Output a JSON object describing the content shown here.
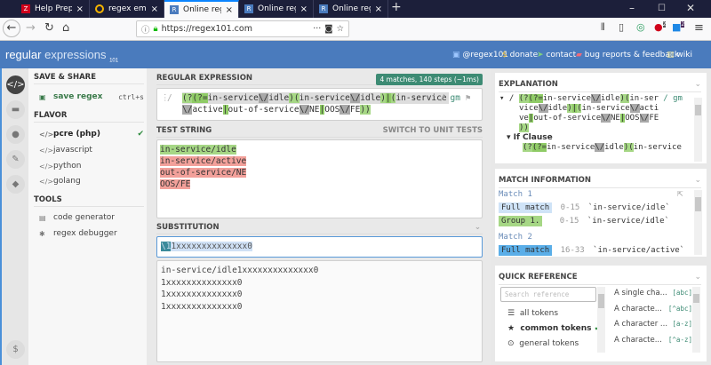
{
  "browser": {
    "tabs": [
      {
        "title": "Help Preprocessing: value s",
        "icon": "Z",
        "color": "#d0021b"
      },
      {
        "title": "regex emulator - Qwant Re",
        "icon": "Q",
        "color": "#5c6bc0"
      },
      {
        "title": "Online regex tester and deb",
        "icon": "R",
        "color": "#4a7bbd",
        "active": true
      },
      {
        "title": "Online regex tester and deb",
        "icon": "R",
        "color": "#4a7bbd"
      },
      {
        "title": "Online regex tester and deb",
        "icon": "R",
        "color": "#4a7bbd"
      }
    ],
    "new_tab": "+",
    "url": "https://regex101.com",
    "badge1": "2",
    "badge2": "2"
  },
  "header": {
    "logo_a": "regular",
    "logo_b": "expressions",
    "logo_c": "101",
    "links": [
      "@regex101",
      "donate",
      "contact",
      "bug reports & feedback",
      "wiki"
    ]
  },
  "sidebar": {
    "save_share": "SAVE & SHARE",
    "save_regex": "save regex",
    "save_shortcut": "ctrl+s",
    "flavor": "FLAVOR",
    "flavors": [
      "pcre (php)",
      "javascript",
      "python",
      "golang"
    ],
    "tools": "TOOLS",
    "tool_items": [
      "code generator",
      "regex debugger"
    ],
    "icon_code": "</>"
  },
  "regex": {
    "title": "REGULAR EXPRESSION",
    "status": "4 matches, 140 steps (~1ms)",
    "delim": "/",
    "flags": "gm",
    "line1": [
      [
        "g",
        "(?"
      ],
      [
        "gd",
        "(?="
      ],
      [
        "",
        "in-service"
      ],
      [
        "gr",
        "\\/"
      ],
      [
        "",
        "idle"
      ],
      [
        "g",
        ")"
      ],
      [
        "g",
        "("
      ],
      [
        "",
        "in-service"
      ],
      [
        "gr",
        "\\/"
      ],
      [
        "",
        "idle"
      ],
      [
        "g",
        ")"
      ],
      [
        "gd",
        "|"
      ],
      [
        "g",
        "("
      ],
      [
        "",
        "in-service"
      ]
    ],
    "line2": [
      [
        "gr",
        "\\/"
      ],
      [
        "",
        "active"
      ],
      [
        "gd",
        "|"
      ],
      [
        "",
        "out-of-service"
      ],
      [
        "gr",
        "\\/"
      ],
      [
        "",
        "NE"
      ],
      [
        "gd",
        "|"
      ],
      [
        "",
        "OOS"
      ],
      [
        "gr",
        "\\/"
      ],
      [
        "",
        "FE"
      ],
      [
        "g",
        "))"
      ]
    ]
  },
  "test": {
    "title": "TEST STRING",
    "switch": "SWITCH TO UNIT TESTS",
    "lines": [
      [
        "g",
        "in-service/idle"
      ],
      [
        "r",
        "in-service/active"
      ],
      [
        "r",
        "out-of-service/NE"
      ],
      [
        "r",
        "OOS/FE"
      ]
    ]
  },
  "substitution": {
    "title": "SUBSTITUTION",
    "input_ref": "\\1",
    "input_rest": "1xxxxxxxxxxxxxx0",
    "results": [
      "in-service/idle1xxxxxxxxxxxxxx0",
      "1xxxxxxxxxxxxxx0",
      "1xxxxxxxxxxxxxx0",
      "1xxxxxxxxxxxxxx0"
    ]
  },
  "explanation": {
    "title": "EXPLANATION",
    "lines": [
      "(?(?=in-service\\/idle)(in-ser",
      "vice\\/idle)|(in-service\\/acti",
      "ve|out-of-service\\/NE|OOS\\/FE",
      "))"
    ],
    "flags": "/ gm",
    "if_clause": "If Clause",
    "sub_line": "(?(?=in-service\\/idle)(in-service"
  },
  "match_info": {
    "title": "MATCH INFORMATION",
    "matches": [
      {
        "label": "Match 1",
        "rows": [
          {
            "name": "Full match",
            "range": "0-15",
            "value": "`in-service/idle`"
          },
          {
            "name": "Group 1.",
            "range": "0-15",
            "value": "`in-service/idle`"
          }
        ]
      },
      {
        "label": "Match 2",
        "rows": [
          {
            "name": "Full match",
            "range": "16-33",
            "value": "`in-service/active`"
          }
        ]
      }
    ]
  },
  "quick_ref": {
    "title": "QUICK REFERENCE",
    "search_placeholder": "Search reference",
    "categories": [
      "all tokens",
      "common tokens",
      "general tokens"
    ],
    "tokens": [
      {
        "desc": "A single cha...",
        "tok": "[abc]"
      },
      {
        "desc": "A characte...",
        "tok": "[^abc]"
      },
      {
        "desc": "A character ...",
        "tok": "[a-z]"
      },
      {
        "desc": "A characte...",
        "tok": "[^a-z]"
      }
    ]
  },
  "colors": {
    "accent": "#4a7bbd",
    "match_green": "#a6d785",
    "no_match_red": "#f2a09a",
    "status_badge": "#3d8b74"
  }
}
